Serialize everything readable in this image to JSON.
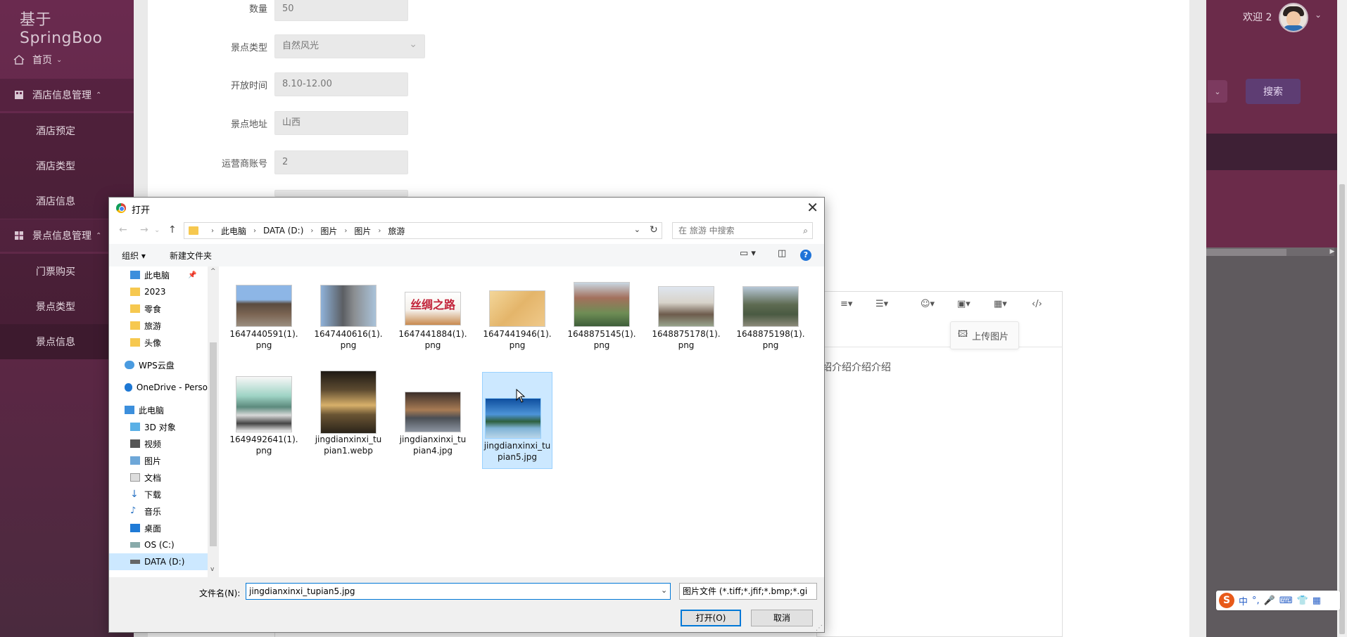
{
  "app": {
    "brand": "基于SpringBoo"
  },
  "sidebar": {
    "items": [
      {
        "label": "首页",
        "icon": "home-icon"
      },
      {
        "label": "酒店信息管理",
        "icon": "building-icon"
      },
      {
        "label": "酒店预定"
      },
      {
        "label": "酒店类型"
      },
      {
        "label": "酒店信息"
      },
      {
        "label": "景点信息管理",
        "icon": "grid-icon"
      },
      {
        "label": "门票购买"
      },
      {
        "label": "景点类型"
      },
      {
        "label": "景点信息"
      }
    ]
  },
  "header": {
    "welcome": "欢迎 2",
    "search_label": "搜索"
  },
  "form": {
    "fields": [
      {
        "label": "数量",
        "value": "50"
      },
      {
        "label": "景点类型",
        "value": "自然风光"
      },
      {
        "label": "开放时间",
        "value": "8.10-12.00"
      },
      {
        "label": "景点地址",
        "value": "山西"
      },
      {
        "label": "运营商账号",
        "value": "2"
      }
    ]
  },
  "editor": {
    "upload_image_label": "上传图片",
    "content": "绍介绍介绍介绍"
  },
  "dialog": {
    "title": "打开",
    "path": [
      "此电脑",
      "DATA (D:)",
      "图片",
      "图片",
      "旅游"
    ],
    "search_placeholder": "在 旅游 中搜索",
    "organize_label": "组织",
    "new_folder_label": "新建文件夹",
    "tree": [
      {
        "label": "此电脑",
        "kind": "pc"
      },
      {
        "label": "2023",
        "kind": "folder"
      },
      {
        "label": "零食",
        "kind": "folder"
      },
      {
        "label": "旅游",
        "kind": "folder"
      },
      {
        "label": "头像",
        "kind": "folder"
      },
      {
        "label": "WPS云盘",
        "kind": "cloud"
      },
      {
        "label": "OneDrive - Perso",
        "kind": "cloud"
      },
      {
        "label": "此电脑",
        "kind": "pc"
      },
      {
        "label": "3D 对象",
        "kind": "3d"
      },
      {
        "label": "视频",
        "kind": "video"
      },
      {
        "label": "图片",
        "kind": "pictures"
      },
      {
        "label": "文档",
        "kind": "docs"
      },
      {
        "label": "下载",
        "kind": "download"
      },
      {
        "label": "音乐",
        "kind": "music"
      },
      {
        "label": "桌面",
        "kind": "desktop"
      },
      {
        "label": "OS (C:)",
        "kind": "drive"
      },
      {
        "label": "DATA (D:)",
        "kind": "drive"
      }
    ],
    "files": [
      {
        "name": "1647440591(1).png",
        "line1": "1647440591(1).",
        "line2": "png"
      },
      {
        "name": "1647440616(1).png",
        "line1": "1647440616(1).",
        "line2": "png"
      },
      {
        "name": "1647441884(1).png",
        "line1": "1647441884(1).",
        "line2": "png"
      },
      {
        "name": "1647441946(1).png",
        "line1": "1647441946(1).",
        "line2": "png"
      },
      {
        "name": "1648875145(1).png",
        "line1": "1648875145(1).",
        "line2": "png"
      },
      {
        "name": "1648875178(1).png",
        "line1": "1648875178(1).",
        "line2": "png"
      },
      {
        "name": "1648875198(1).png",
        "line1": "1648875198(1).",
        "line2": "png"
      },
      {
        "name": "1649492641(1).png",
        "line1": "1649492641(1).",
        "line2": "png"
      },
      {
        "name": "jingdianxinxi_tupian1.webp",
        "line1": "jingdianxinxi_tu",
        "line2": "pian1.webp"
      },
      {
        "name": "jingdianxinxi_tupian4.jpg",
        "line1": "jingdianxinxi_tu",
        "line2": "pian4.jpg"
      },
      {
        "name": "jingdianxinxi_tupian5.jpg",
        "line1": "jingdianxinxi_tu",
        "line2": "pian5.jpg"
      }
    ],
    "selected_file_index": 10,
    "thumb_image_text": "丝绸之路",
    "filename_label": "文件名(N):",
    "filename_value": "jingdianxinxi_tupian5.jpg",
    "filetype_value": "图片文件 (*.tiff;*.jfif;*.bmp;*.gi",
    "open_label": "打开(O)",
    "cancel_label": "取消"
  },
  "ime": {
    "lang": "中"
  },
  "colors": {
    "sidebar": "#6a2a4f",
    "selection": "#cce8ff",
    "accent": "#0078d7"
  }
}
